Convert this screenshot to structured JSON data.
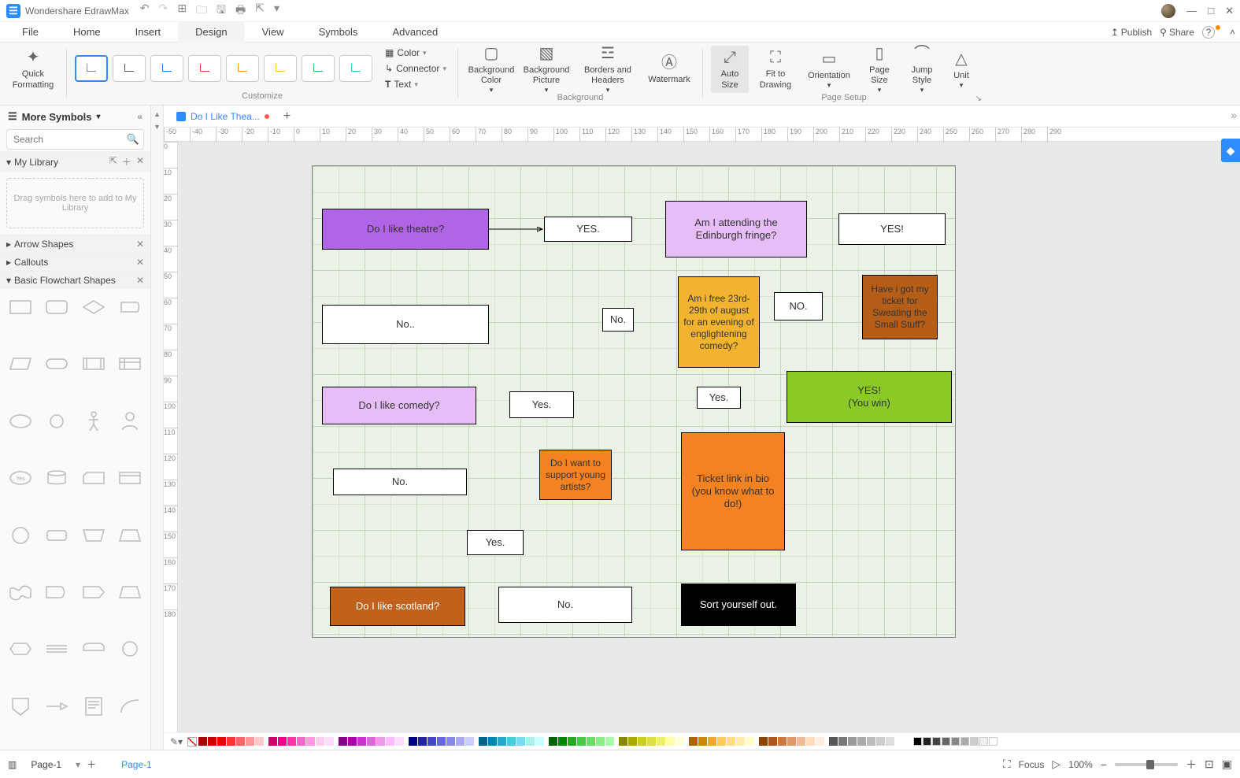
{
  "app": {
    "title": "Wondershare EdrawMax"
  },
  "qat": {
    "undo": "↶",
    "redo": "↷",
    "new": "⊞",
    "open": "🗀",
    "save": "🖫",
    "print": "🖶",
    "export": "⇱",
    "more": "▾"
  },
  "window": {
    "min": "—",
    "max": "□",
    "close": "✕"
  },
  "menu": {
    "items": [
      "File",
      "Home",
      "Insert",
      "Design",
      "View",
      "Symbols",
      "Advanced"
    ],
    "active": 3,
    "right": {
      "publish": "Publish",
      "share": "Share",
      "help": "?",
      "collapse": "˄"
    }
  },
  "ribbon": {
    "quick_formatting": "Quick\nFormatting",
    "customize_label": "Customize",
    "color": "Color",
    "connector": "Connector",
    "text": "Text",
    "bg_color": "Background\nColor",
    "bg_pic": "Background\nPicture",
    "borders": "Borders and\nHeaders",
    "watermark": "Watermark",
    "bg_label": "Background",
    "auto_size": "Auto\nSize",
    "fit": "Fit to\nDrawing",
    "orientation": "Orientation",
    "page_size": "Page\nSize",
    "jump_style": "Jump\nStyle",
    "unit": "Unit",
    "page_setup_label": "Page Setup"
  },
  "left": {
    "more_symbols": "More Symbols",
    "search_ph": "Search",
    "my_library": "My Library",
    "drag_hint": "Drag symbols here to add to My Library",
    "arrow_shapes": "Arrow Shapes",
    "callouts": "Callouts",
    "basic_flowchart": "Basic Flowchart Shapes"
  },
  "doc": {
    "tab_name": "Do I Like Thea...",
    "add": "+"
  },
  "ruler_h": [
    -50,
    -40,
    -30,
    -20,
    -10,
    0,
    10,
    20,
    30,
    40,
    50,
    60,
    70,
    80,
    90,
    100,
    110,
    120,
    130,
    140,
    150,
    160,
    170,
    180,
    190,
    200,
    210,
    220,
    230,
    240,
    250,
    260,
    270,
    280,
    290
  ],
  "ruler_v": [
    0,
    10,
    20,
    30,
    40,
    50,
    60,
    70,
    80,
    90,
    100,
    110,
    120,
    130,
    140,
    150,
    160,
    170,
    180
  ],
  "nodes": {
    "n1": "Do I like theatre?",
    "n2": "YES.",
    "n3": "Am I attending the Edinburgh fringe?",
    "n4": "YES!",
    "n5": "Have i got my ticket for Sweating the Small Stuff?",
    "n6": "NO.",
    "n7": "Am i free 23rd-29th of august for an evening of englightening comedy?",
    "n8": "No..",
    "n9": "No.",
    "n10": "Do I like comedy?",
    "n11": "Yes.",
    "n12": "Yes.",
    "n13": "YES!\n(You win)",
    "n14": "No.",
    "n15": "Do I want to support young artists?",
    "n16": "Yes.",
    "n17": "Ticket link in bio (you know what to do!)",
    "n18": "Do I like scotland?",
    "n19": "No.",
    "n20": "Sort yourself out."
  },
  "swatches": {
    "groups": [
      [
        "#a00",
        "#c00",
        "#e00",
        "#f33",
        "#f66",
        "#f99",
        "#fcc"
      ],
      [
        "#c06",
        "#e08",
        "#f3a",
        "#f6c",
        "#f9d",
        "#fce",
        "#fdf"
      ],
      [
        "#808",
        "#a0a",
        "#c3c",
        "#d6d",
        "#e9e",
        "#fbf",
        "#fdf"
      ],
      [
        "#008",
        "#22a",
        "#44c",
        "#66d",
        "#88e",
        "#aae",
        "#ccf"
      ],
      [
        "#068",
        "#08a",
        "#2ac",
        "#4cd",
        "#7de",
        "#aee",
        "#cff"
      ],
      [
        "#060",
        "#080",
        "#2a2",
        "#4c4",
        "#6d6",
        "#8e8",
        "#afa"
      ],
      [
        "#880",
        "#aa0",
        "#cc2",
        "#dd4",
        "#ee7",
        "#ffa",
        "#ffd"
      ],
      [
        "#a60",
        "#c80",
        "#ea2",
        "#fc5",
        "#fd8",
        "#fea",
        "#ffc"
      ],
      [
        "#840",
        "#a52",
        "#c74",
        "#d96",
        "#eb9",
        "#fdb",
        "#fed"
      ],
      [
        "#555",
        "#777",
        "#999",
        "#aaa",
        "#bbb",
        "#ccc",
        "#ddd"
      ]
    ],
    "bw": [
      "#000",
      "#222",
      "#444",
      "#666",
      "#888",
      "#aaa",
      "#ccc",
      "#eee",
      "#fff"
    ]
  },
  "status": {
    "page_name": "Page-1",
    "page_link": "Page-1",
    "focus": "Focus",
    "zoom": "100%"
  }
}
